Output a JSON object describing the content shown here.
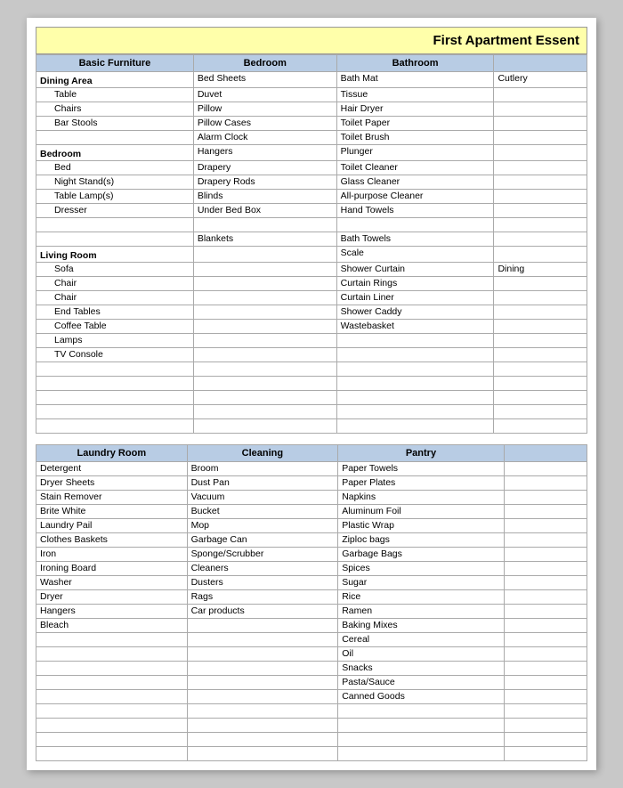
{
  "title": "First Apartment Essent",
  "headers": {
    "basic_furniture": "Basic Furniture",
    "bedroom": "Bedroom",
    "bathroom": "Bathroom",
    "cutlery": "Cutlery",
    "laundry": "Laundry Room",
    "cleaning": "Cleaning",
    "pantry": "Pantry",
    "extra": ""
  },
  "top_section": {
    "basic_furniture": [
      {
        "text": "Dining Area",
        "type": "section"
      },
      {
        "text": "Table",
        "type": "indented"
      },
      {
        "text": "Chairs",
        "type": "indented"
      },
      {
        "text": "Bar Stools",
        "type": "indented"
      },
      {
        "text": "",
        "type": "empty"
      },
      {
        "text": "Bedroom",
        "type": "section"
      },
      {
        "text": "Bed",
        "type": "indented"
      },
      {
        "text": "Night Stand(s)",
        "type": "indented"
      },
      {
        "text": "Table Lamp(s)",
        "type": "indented"
      },
      {
        "text": "Dresser",
        "type": "indented"
      },
      {
        "text": "",
        "type": "empty"
      },
      {
        "text": "",
        "type": "empty"
      },
      {
        "text": "Living Room",
        "type": "section"
      },
      {
        "text": "Sofa",
        "type": "indented"
      },
      {
        "text": "Chair",
        "type": "indented"
      },
      {
        "text": "Chair",
        "type": "indented"
      },
      {
        "text": "End Tables",
        "type": "indented"
      },
      {
        "text": "Coffee Table",
        "type": "indented"
      },
      {
        "text": "Lamps",
        "type": "indented"
      },
      {
        "text": "TV Console",
        "type": "indented"
      },
      {
        "text": "",
        "type": "empty"
      },
      {
        "text": "",
        "type": "empty"
      },
      {
        "text": "",
        "type": "empty"
      },
      {
        "text": "",
        "type": "empty"
      },
      {
        "text": "",
        "type": "empty"
      }
    ],
    "bedroom": [
      {
        "text": "Bed Sheets",
        "type": "normal"
      },
      {
        "text": "Duvet",
        "type": "normal"
      },
      {
        "text": "Pillow",
        "type": "normal"
      },
      {
        "text": "Pillow Cases",
        "type": "normal"
      },
      {
        "text": "Alarm Clock",
        "type": "normal"
      },
      {
        "text": "Hangers",
        "type": "normal"
      },
      {
        "text": "Drapery",
        "type": "normal"
      },
      {
        "text": "Drapery Rods",
        "type": "normal"
      },
      {
        "text": "Blinds",
        "type": "normal"
      },
      {
        "text": "Under Bed Box",
        "type": "normal"
      },
      {
        "text": "",
        "type": "empty"
      },
      {
        "text": "Blankets",
        "type": "normal"
      },
      {
        "text": "",
        "type": "empty"
      },
      {
        "text": "",
        "type": "empty"
      },
      {
        "text": "",
        "type": "empty"
      },
      {
        "text": "",
        "type": "empty"
      },
      {
        "text": "",
        "type": "empty"
      },
      {
        "text": "",
        "type": "empty"
      },
      {
        "text": "",
        "type": "empty"
      },
      {
        "text": "",
        "type": "empty"
      },
      {
        "text": "",
        "type": "empty"
      },
      {
        "text": "",
        "type": "empty"
      },
      {
        "text": "",
        "type": "empty"
      },
      {
        "text": "",
        "type": "empty"
      },
      {
        "text": "",
        "type": "empty"
      }
    ],
    "bathroom": [
      {
        "text": "Bath Mat",
        "type": "normal"
      },
      {
        "text": "Tissue",
        "type": "normal"
      },
      {
        "text": "Hair Dryer",
        "type": "normal"
      },
      {
        "text": "Toilet Paper",
        "type": "normal"
      },
      {
        "text": "Toilet Brush",
        "type": "normal"
      },
      {
        "text": "Plunger",
        "type": "normal"
      },
      {
        "text": "Toilet Cleaner",
        "type": "normal"
      },
      {
        "text": "Glass Cleaner",
        "type": "normal"
      },
      {
        "text": "All-purpose Cleaner",
        "type": "normal"
      },
      {
        "text": "Hand Towels",
        "type": "normal"
      },
      {
        "text": "",
        "type": "empty"
      },
      {
        "text": "Bath Towels",
        "type": "normal"
      },
      {
        "text": "Scale",
        "type": "normal"
      },
      {
        "text": "Shower Curtain",
        "type": "normal"
      },
      {
        "text": "Curtain Rings",
        "type": "normal"
      },
      {
        "text": "Curtain Liner",
        "type": "normal"
      },
      {
        "text": "Shower Caddy",
        "type": "normal"
      },
      {
        "text": "Wastebasket",
        "type": "normal"
      },
      {
        "text": "",
        "type": "empty"
      },
      {
        "text": "",
        "type": "empty"
      },
      {
        "text": "",
        "type": "empty"
      },
      {
        "text": "",
        "type": "empty"
      },
      {
        "text": "",
        "type": "empty"
      },
      {
        "text": "",
        "type": "empty"
      },
      {
        "text": "",
        "type": "empty"
      }
    ],
    "cutlery": [
      {
        "text": "Cutlery",
        "type": "normal"
      },
      {
        "text": "",
        "type": "empty"
      },
      {
        "text": "",
        "type": "empty"
      },
      {
        "text": "",
        "type": "empty"
      },
      {
        "text": "",
        "type": "empty"
      },
      {
        "text": "",
        "type": "empty"
      },
      {
        "text": "",
        "type": "empty"
      },
      {
        "text": "",
        "type": "empty"
      },
      {
        "text": "",
        "type": "empty"
      },
      {
        "text": "",
        "type": "empty"
      },
      {
        "text": "",
        "type": "empty"
      },
      {
        "text": "",
        "type": "empty"
      },
      {
        "text": "",
        "type": "empty"
      },
      {
        "text": "Dining",
        "type": "normal"
      },
      {
        "text": "",
        "type": "empty"
      },
      {
        "text": "",
        "type": "empty"
      },
      {
        "text": "",
        "type": "empty"
      },
      {
        "text": "",
        "type": "empty"
      },
      {
        "text": "",
        "type": "empty"
      },
      {
        "text": "",
        "type": "empty"
      },
      {
        "text": "",
        "type": "empty"
      },
      {
        "text": "",
        "type": "empty"
      },
      {
        "text": "",
        "type": "empty"
      },
      {
        "text": "",
        "type": "empty"
      },
      {
        "text": "",
        "type": "empty"
      }
    ]
  },
  "bottom_section": {
    "laundry": [
      "Detergent",
      "Dryer Sheets",
      "Stain Remover",
      "Brite White",
      "Laundry Pail",
      "Clothes Baskets",
      "Iron",
      "Ironing Board",
      "Washer",
      "Dryer",
      "Hangers",
      "Bleach",
      "",
      "",
      "",
      "",
      "",
      "",
      "",
      "",
      ""
    ],
    "cleaning": [
      "Broom",
      "Dust Pan",
      "Vacuum",
      "Bucket",
      "Mop",
      "Garbage Can",
      "Sponge/Scrubber",
      "Cleaners",
      "Dusters",
      "Rags",
      "Car products",
      "",
      "",
      "",
      "",
      "",
      "",
      "",
      "",
      "",
      ""
    ],
    "pantry": [
      "Paper Towels",
      "Paper Plates",
      "Napkins",
      "Aluminum Foil",
      "Plastic Wrap",
      "Ziploc bags",
      "Garbage Bags",
      "Spices",
      "Sugar",
      "Rice",
      "Ramen",
      "Baking Mixes",
      "Cereal",
      "Oil",
      "Snacks",
      "Pasta/Sauce",
      "Canned Goods",
      "",
      "",
      "",
      ""
    ],
    "extra": [
      "",
      "",
      "",
      "",
      "",
      "",
      "",
      "",
      "",
      "",
      "",
      "",
      "",
      "",
      "",
      "",
      "",
      "",
      "",
      "",
      ""
    ]
  }
}
